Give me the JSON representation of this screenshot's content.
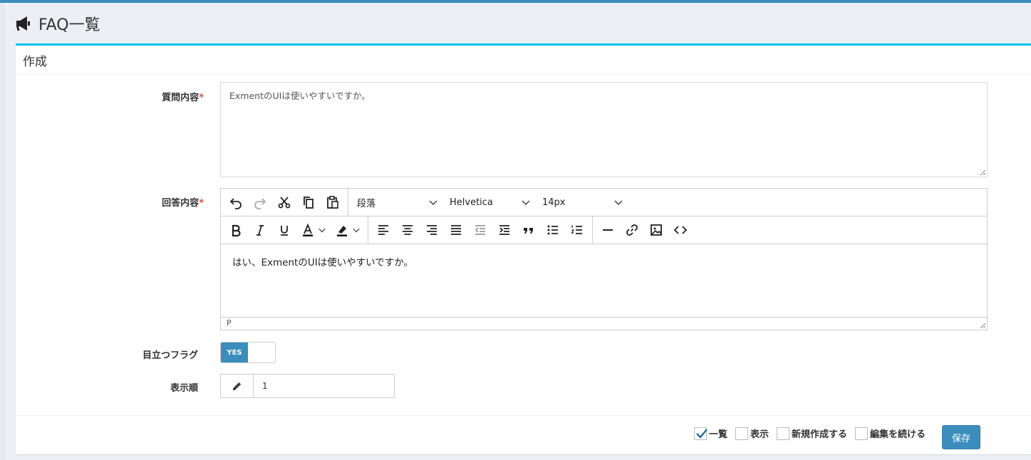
{
  "header": {
    "title": "FAQ一覧",
    "icon": "bullhorn-icon"
  },
  "box": {
    "title": "作成"
  },
  "fields": {
    "question": {
      "label": "質問内容",
      "required_mark": "*",
      "value": "ExmentのUIは使いやすいですか。"
    },
    "answer": {
      "label": "回答内容",
      "required_mark": "*",
      "format_select": "段落",
      "font_select": "Helvetica",
      "size_select": "14px",
      "content": "はい、ExmentのUIは使いやすいですか。",
      "status_path": "P"
    },
    "featured": {
      "label": "目立つフラグ",
      "toggle_on": "YES",
      "state": "on"
    },
    "order": {
      "label": "表示順",
      "value": "1"
    }
  },
  "footer": {
    "options": [
      {
        "label": "一覧",
        "checked": true
      },
      {
        "label": "表示",
        "checked": false
      },
      {
        "label": "新規作成する",
        "checked": false
      },
      {
        "label": "編集を続ける",
        "checked": false
      }
    ],
    "save_label": "保存"
  },
  "colors": {
    "accent": "#3c8dbc",
    "box_border": "#00c0ef",
    "required": "#dd4b39"
  }
}
